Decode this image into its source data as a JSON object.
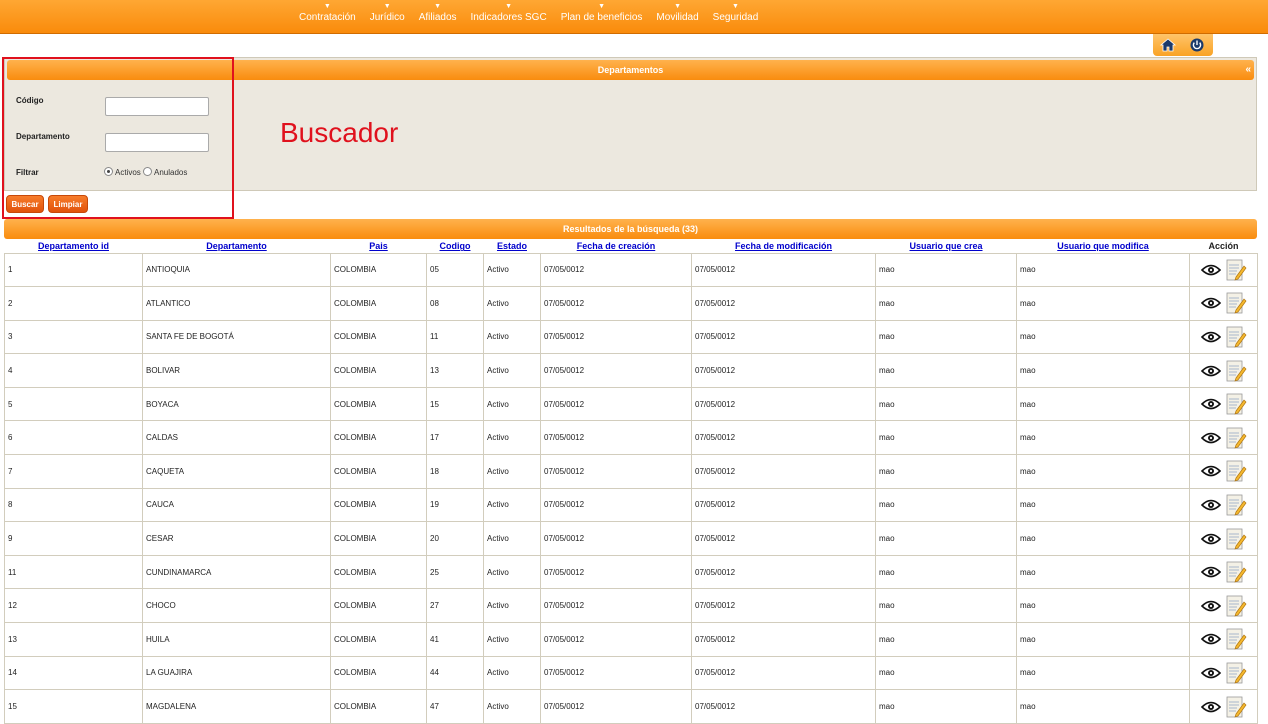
{
  "nav": {
    "items": [
      {
        "label": "Contratación"
      },
      {
        "label": "Jurídico"
      },
      {
        "label": "Afiliados"
      },
      {
        "label": "Indicadores SGC"
      },
      {
        "label": "Plan de beneficios"
      },
      {
        "label": "Movilidad"
      },
      {
        "label": "Seguridad"
      }
    ],
    "arrow": "▼"
  },
  "icons": {
    "home": "home-icon",
    "power": "power-icon"
  },
  "search": {
    "title": "Departamentos",
    "collapse": "«",
    "codigo_label": "Código",
    "codigo_value": "",
    "departamento_label": "Departamento",
    "departamento_value": "",
    "filtrar_label": "Filtrar",
    "radio_activos": "Activos",
    "radio_anulados": "Anulados",
    "selected_filter": "Activos",
    "buscar": "Buscar",
    "limpiar": "Limpiar"
  },
  "annotation": {
    "text": "Buscador",
    "color": "#e0111d"
  },
  "results": {
    "title": "Resultados de la búsqueda (33)",
    "columns": [
      "Departamento id",
      "Departamento",
      "Pais",
      "Codigo",
      "Estado",
      "Fecha de creación",
      "Fecha de modificación",
      "Usuario que crea",
      "Usuario que modifica",
      "Acción"
    ],
    "rows": [
      [
        "1",
        "ANTIOQUIA",
        "COLOMBIA",
        "05",
        "Activo",
        "07/05/0012",
        "07/05/0012",
        "mao",
        "mao"
      ],
      [
        "2",
        "ATLANTICO",
        "COLOMBIA",
        "08",
        "Activo",
        "07/05/0012",
        "07/05/0012",
        "mao",
        "mao"
      ],
      [
        "3",
        "SANTA FE DE BOGOTÁ",
        "COLOMBIA",
        "11",
        "Activo",
        "07/05/0012",
        "07/05/0012",
        "mao",
        "mao"
      ],
      [
        "4",
        "BOLIVAR",
        "COLOMBIA",
        "13",
        "Activo",
        "07/05/0012",
        "07/05/0012",
        "mao",
        "mao"
      ],
      [
        "5",
        "BOYACA",
        "COLOMBIA",
        "15",
        "Activo",
        "07/05/0012",
        "07/05/0012",
        "mao",
        "mao"
      ],
      [
        "6",
        "CALDAS",
        "COLOMBIA",
        "17",
        "Activo",
        "07/05/0012",
        "07/05/0012",
        "mao",
        "mao"
      ],
      [
        "7",
        "CAQUETA",
        "COLOMBIA",
        "18",
        "Activo",
        "07/05/0012",
        "07/05/0012",
        "mao",
        "mao"
      ],
      [
        "8",
        "CAUCA",
        "COLOMBIA",
        "19",
        "Activo",
        "07/05/0012",
        "07/05/0012",
        "mao",
        "mao"
      ],
      [
        "9",
        "CESAR",
        "COLOMBIA",
        "20",
        "Activo",
        "07/05/0012",
        "07/05/0012",
        "mao",
        "mao"
      ],
      [
        "11",
        "CUNDINAMARCA",
        "COLOMBIA",
        "25",
        "Activo",
        "07/05/0012",
        "07/05/0012",
        "mao",
        "mao"
      ],
      [
        "12",
        "CHOCO",
        "COLOMBIA",
        "27",
        "Activo",
        "07/05/0012",
        "07/05/0012",
        "mao",
        "mao"
      ],
      [
        "13",
        "HUILA",
        "COLOMBIA",
        "41",
        "Activo",
        "07/05/0012",
        "07/05/0012",
        "mao",
        "mao"
      ],
      [
        "14",
        "LA GUAJIRA",
        "COLOMBIA",
        "44",
        "Activo",
        "07/05/0012",
        "07/05/0012",
        "mao",
        "mao"
      ],
      [
        "15",
        "MAGDALENA",
        "COLOMBIA",
        "47",
        "Activo",
        "07/05/0012",
        "07/05/0012",
        "mao",
        "mao"
      ]
    ],
    "row_actions": [
      "eye-icon",
      "edit-icon"
    ]
  },
  "colors": {
    "accent": "#f98c0e",
    "panel": "#ece8df",
    "link": "#0000cc"
  }
}
